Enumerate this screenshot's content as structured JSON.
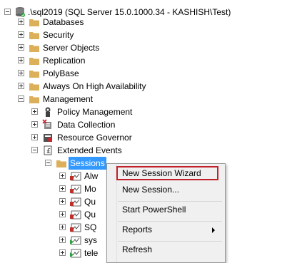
{
  "tree": {
    "server": ".\\sql2019 (SQL Server 15.0.1000.34 - KASHISH\\Test)",
    "databases": "Databases",
    "security": "Security",
    "server_objects": "Server Objects",
    "replication": "Replication",
    "polybase": "PolyBase",
    "always_on": "Always On High Availability",
    "management": "Management",
    "policy_management": "Policy Management",
    "data_collection": "Data Collection",
    "resource_governor": "Resource Governor",
    "extended_events": "Extended Events",
    "sessions": "Sessions",
    "session_items": [
      "Alw",
      "Mo",
      "Qu",
      "Qu",
      "SQ",
      "sys",
      "tele"
    ]
  },
  "context_menu": {
    "new_session_wizard": "New Session Wizard",
    "new_session": "New Session...",
    "start_powershell": "Start PowerShell",
    "reports": "Reports",
    "refresh": "Refresh"
  },
  "colors": {
    "selection": "#3399ff",
    "highlight_box": "#c0202a",
    "folder": "#dcb05a"
  }
}
